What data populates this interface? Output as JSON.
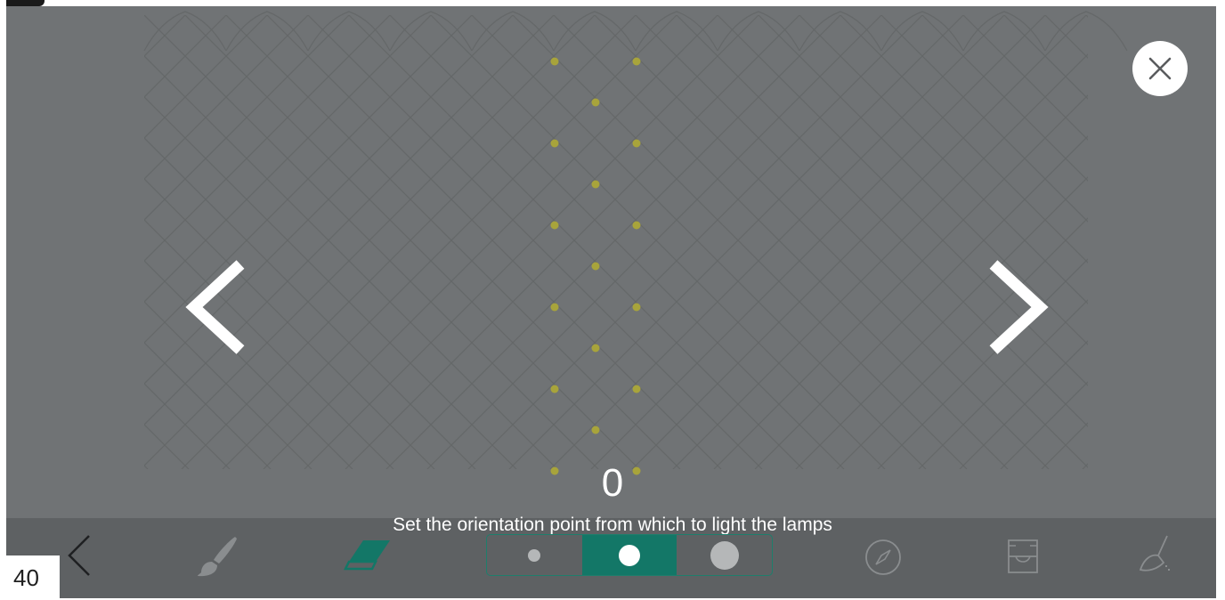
{
  "close_icon": "close-icon",
  "navigation": {
    "prev_icon": "chevron-left-icon",
    "next_icon": "chevron-right-icon"
  },
  "counter": "0",
  "hint": "Set the orientation point from which to light the lamps",
  "toolbar": {
    "back_icon": "chevron-left-icon",
    "tools": [
      "brush-icon",
      "eraser-icon",
      "compass-icon",
      "tray-icon",
      "broom-icon"
    ],
    "sizes": [
      "small",
      "medium",
      "large"
    ],
    "selected_size": "medium"
  },
  "corner_number": "40",
  "colors": {
    "background": "#707375",
    "grid_line": "#656869",
    "lamp_lit": "#a8a43b",
    "accent": "#137767",
    "toolbar": "#5e6163"
  }
}
